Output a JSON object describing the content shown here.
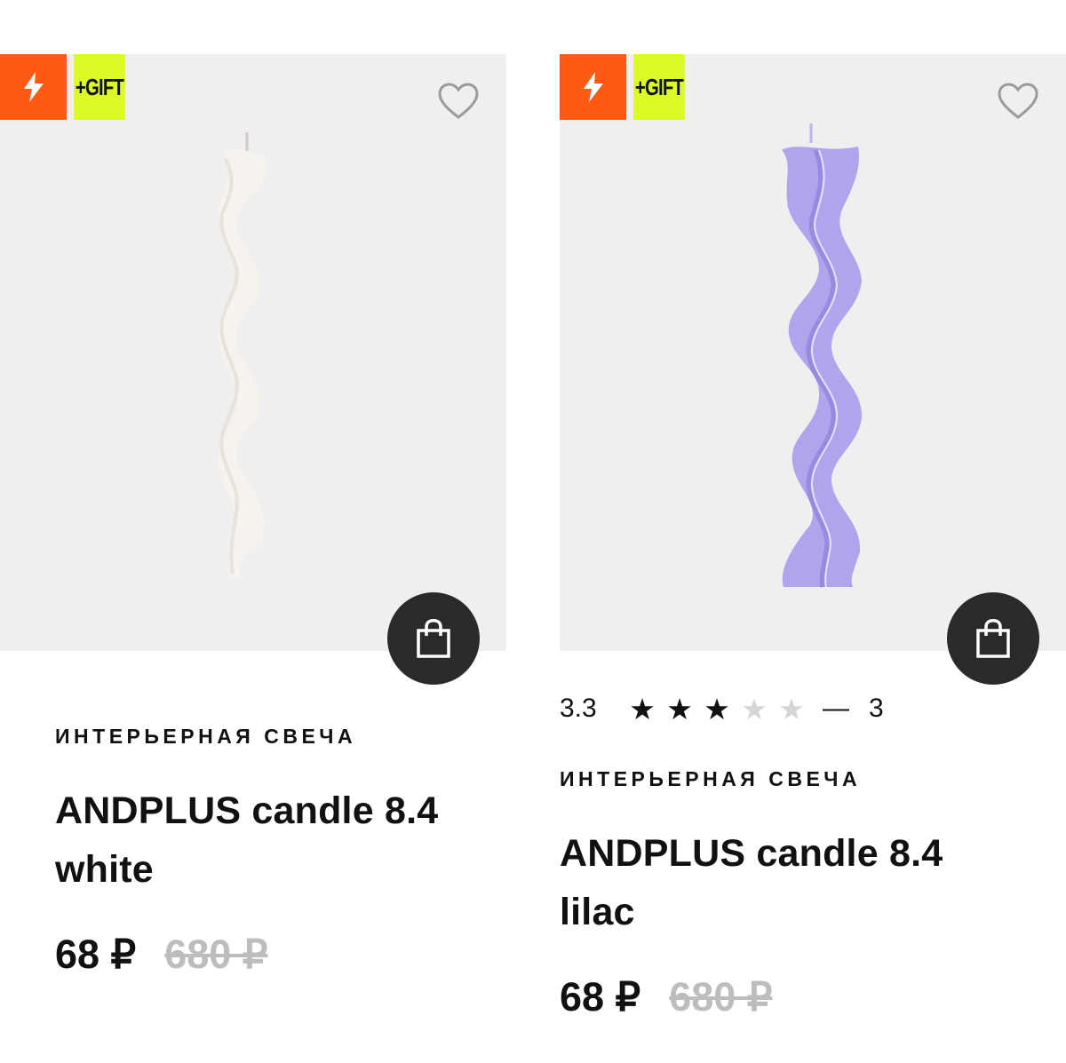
{
  "products": [
    {
      "badge_icon": "lightning-icon",
      "badge_text": "+GIFT",
      "favorite_icon": "heart-icon",
      "cart_icon": "shopping-bag-icon",
      "candle_color": "#f6f3ee",
      "category": "ИНТЕРЬЕРНАЯ СВЕЧА",
      "title_line1": "ANDPLUS  candle 8.4",
      "title_line2": "white",
      "price": "68 ₽",
      "old_price": "680 ₽"
    },
    {
      "badge_icon": "lightning-icon",
      "badge_text": "+GIFT",
      "favorite_icon": "heart-icon",
      "cart_icon": "shopping-bag-icon",
      "candle_color": "#b3a6ec",
      "rating": {
        "value": "3.3",
        "stars_filled": 3,
        "stars_total": 5,
        "separator": "—",
        "count": "3"
      },
      "category": "ИНТЕРЬЕРНАЯ СВЕЧА",
      "title_line1": "ANDPLUS  candle 8.4",
      "title_line2": "lilac",
      "price": "68 ₽",
      "old_price": "680 ₽"
    }
  ],
  "colors": {
    "badge_orange": "#ff5a14",
    "badge_lime": "#dcfb24",
    "image_bg": "#efefef",
    "cart_button": "#2a2a2a",
    "old_price": "#bdbdbd"
  }
}
